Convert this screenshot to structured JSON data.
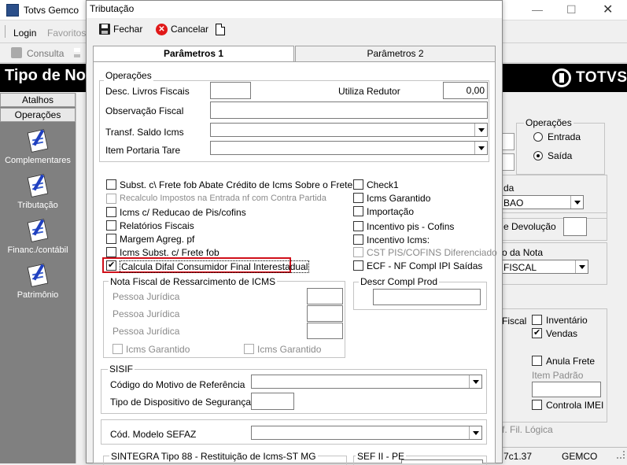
{
  "app": {
    "title": "Totvs Gemco",
    "menu": [
      "Login",
      "Favoritos"
    ],
    "toolbar_consulta": "Consulta",
    "header_title": "Tipo de Nota",
    "brand": "TOTVS",
    "status_text": "7c1.37",
    "status_app": "GEMCO"
  },
  "sidebar": {
    "tabs": [
      "Atalhos",
      "Operações"
    ],
    "items": [
      {
        "label": "Complementares",
        "icon": "document-pen-icon"
      },
      {
        "label": "Tributação",
        "icon": "document-pen-icon"
      },
      {
        "label": "Financ./contábil",
        "icon": "document-pen-icon"
      },
      {
        "label": "Patrimônio",
        "icon": "document-pen-icon"
      }
    ]
  },
  "right_panel": {
    "operacoes_label": "Operações",
    "entrada": "Entrada",
    "saida": "Saída",
    "selected": "Saída",
    "frag_da": "da",
    "frag_bao": "BAO",
    "devolucao": "e Devolução",
    "da_nota": "o da Nota",
    "fiscal_combo": "FISCAL",
    "fiscal": "Fiscal",
    "inventario": "Inventário",
    "vendas": "Vendas",
    "anula_frete": "Anula Frete",
    "item_padrao": "Item Padrão",
    "controla_imei": "Controla IMEI",
    "fil_logica": "f. Fil. Lógica"
  },
  "dialog": {
    "title": "Tributação",
    "fechar": "Fechar",
    "cancelar": "Cancelar",
    "tabs": [
      "Parâmetros 1",
      "Parâmetros 2"
    ],
    "operacoes_group": "Operações",
    "desc_livros": "Desc. Livros Fiscais",
    "utiliza_redutor": "Utiliza Redutor",
    "redutor_value": "0,00",
    "obs_fiscal": "Observação Fiscal",
    "transf_saldo": "Transf. Saldo Icms",
    "item_portaria": "Item Portaria Tare",
    "checks_left": [
      {
        "label": "Subst. c\\ Frete fob Abate Crédito de Icms Sobre o Frete",
        "checked": false,
        "disabled": false
      },
      {
        "label": "Recalculo Impostos na Entrada nf com Contra Partida",
        "checked": false,
        "disabled": true
      },
      {
        "label": "Icms c/ Reducao de Pis/cofins",
        "checked": false,
        "disabled": false
      },
      {
        "label": "Relatórios Fiscais",
        "checked": false,
        "disabled": false
      },
      {
        "label": "Margem Agreg. pf",
        "checked": false,
        "disabled": false
      },
      {
        "label": "Icms Subst. c/ Frete fob",
        "checked": false,
        "disabled": false
      },
      {
        "label": "Calcula Difal Consumidor Final Interestadual",
        "checked": true,
        "disabled": false
      }
    ],
    "checks_right": [
      {
        "label": "Check1",
        "checked": false,
        "disabled": false
      },
      {
        "label": "Icms Garantido",
        "checked": false,
        "disabled": false
      },
      {
        "label": "Importação",
        "checked": false,
        "disabled": false
      },
      {
        "label": "Incentivo pis - Cofins",
        "checked": false,
        "disabled": false
      },
      {
        "label": "Incentivo Icms:",
        "checked": false,
        "disabled": false
      },
      {
        "label": "CST PIS/COFINS Diferenciado",
        "checked": false,
        "disabled": true
      },
      {
        "label": "ECF - NF Compl IPI Saídas",
        "checked": false,
        "disabled": false
      }
    ],
    "ressarcimento_group": "Nota Fiscal de Ressarcimento de ICMS",
    "pessoa_juridica": [
      "Pessoa Jurídica",
      "Pessoa Jurídica",
      "Pessoa Jurídica"
    ],
    "icms_garantido_1": "Icms Garantido",
    "icms_garantido_2": "Icms Garantido",
    "descr_compl": "Descr Compl Prod",
    "sisif_group": "SISIF",
    "codigo_motivo": "Código do Motivo de Referência",
    "tipo_dispositivo": "Tipo de Dispositivo de Segurança",
    "cod_modelo": "Cód. Modelo SEFAZ",
    "sintegra_group": "SINTEGRA Tipo 88 - Restituição de Icms-ST MG",
    "sef_group": "SEF II - PE"
  },
  "colors": {
    "highlight": "#d0101a",
    "header_bg": "#000000"
  }
}
